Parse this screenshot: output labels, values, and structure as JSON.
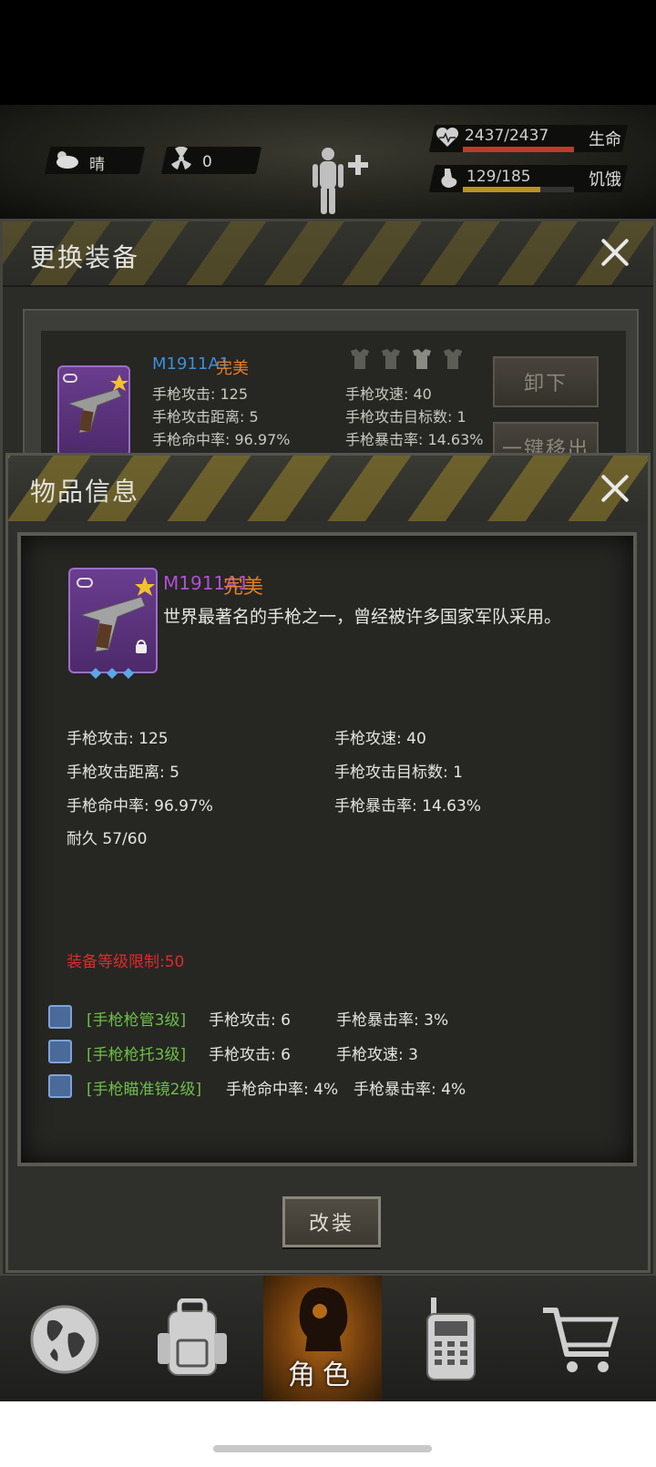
{
  "status": {
    "weather": "晴",
    "radiation": "0",
    "health": {
      "value": "2437/2437",
      "label": "生命",
      "fraction": 1.0,
      "color": "#c0392b"
    },
    "hunger": {
      "value": "129/185",
      "label": "饥饿",
      "fraction": 0.7,
      "color": "#b8941f"
    }
  },
  "change_panel": {
    "title": "更换装备",
    "item_name": "M1911A1",
    "quality": "完美",
    "stats": [
      "手枪攻击: 125",
      "手枪攻速: 40",
      "手枪攻击距离: 5",
      "手枪攻击目标数: 1",
      "手枪命中率: 96.97%",
      "手枪暴击率: 14.63%"
    ],
    "unequip_label": "卸下",
    "remove_all_label": "一键移出"
  },
  "info_dialog": {
    "title": "物品信息",
    "item_name": "M1911A1",
    "quality": "完美",
    "description": "世界最著名的手枪之一，曾经被许多国家军队采用。",
    "attrs": [
      "手枪攻击: 125",
      "手枪攻速: 40",
      "手枪攻击距离: 5",
      "手枪攻击目标数: 1",
      "手枪命中率: 96.97%",
      "手枪暴击率: 14.63%"
    ],
    "durability": "耐久 57/60",
    "level_limit": "装备等级限制:50",
    "mods": [
      {
        "name": "[手枪枪管3级]",
        "stat1": "手枪攻击: 6",
        "stat2": "手枪暴击率: 3%"
      },
      {
        "name": "[手枪枪托3级]",
        "stat1": "手枪攻击: 6",
        "stat2": "手枪攻速: 3"
      },
      {
        "name": "[手枪瞄准镜2级]",
        "stat1": "手枪命中率: 4%",
        "stat2": "手枪暴击率: 4%"
      }
    ],
    "modify_label": "改装"
  },
  "nav": {
    "active_label": "角色",
    "icons": [
      "globe-icon",
      "backpack-icon",
      "character-icon",
      "radio-icon",
      "cart-icon"
    ]
  },
  "colors": {
    "item_name_blue": "#3b8fd9",
    "item_name_purple": "#b04fd6",
    "quality_orange": "#e67e22",
    "level_limit_red": "#e02a2a",
    "mod_green": "#6dbf47"
  }
}
